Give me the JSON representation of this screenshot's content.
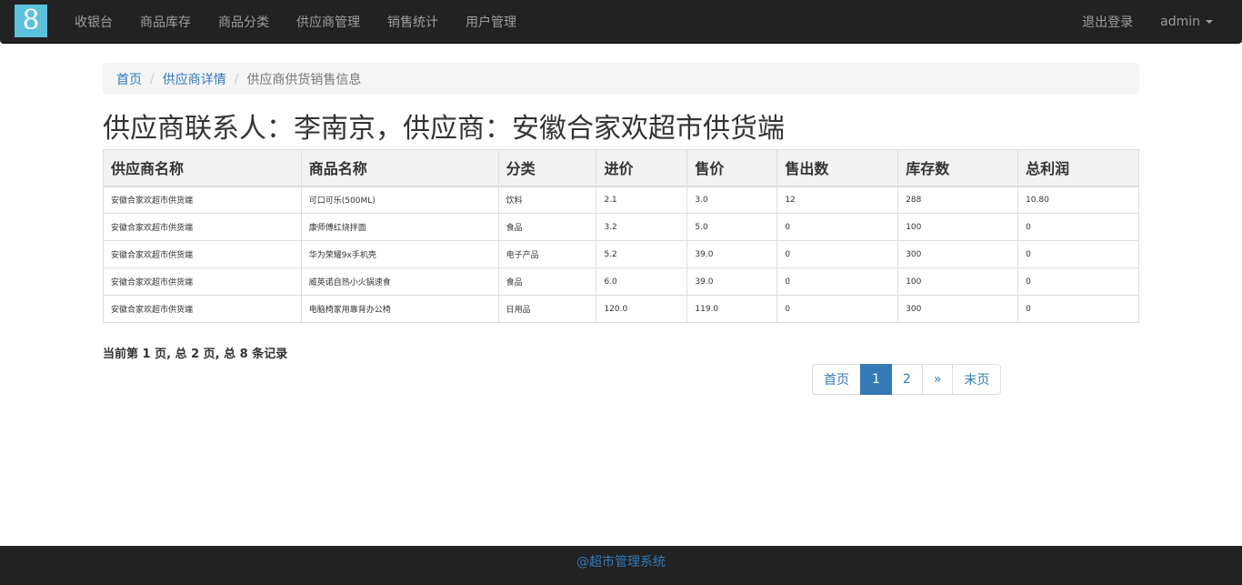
{
  "navbar": {
    "brand": "8",
    "items": [
      "收银台",
      "商品库存",
      "商品分类",
      "供应商管理",
      "销售统计",
      "用户管理"
    ],
    "logout": "退出登录",
    "user": "admin"
  },
  "breadcrumb": [
    "首页",
    "供应商详情",
    "供应商供货销售信息"
  ],
  "title": "供应商联系人：李南京，供应商：安徽合家欢超市供货端",
  "table": {
    "headers": [
      "供应商名称",
      "商品名称",
      "分类",
      "进价",
      "售价",
      "售出数",
      "库存数",
      "总利润"
    ],
    "rows": [
      [
        "安徽合家欢超市供货端",
        "可口可乐(500ML)",
        "饮料",
        "2.1",
        "3.0",
        "12",
        "288",
        "10.80"
      ],
      [
        "安徽合家欢超市供货端",
        "康师傅红烧拌面",
        "食品",
        "3.2",
        "5.0",
        "0",
        "100",
        "0"
      ],
      [
        "安徽合家欢超市供货端",
        "华为荣耀9x手机壳",
        "电子产品",
        "5.2",
        "39.0",
        "0",
        "300",
        "0"
      ],
      [
        "安徽合家欢超市供货端",
        "威英诺自热小火锅速食",
        "食品",
        "6.0",
        "39.0",
        "0",
        "100",
        "0"
      ],
      [
        "安徽合家欢超市供货端",
        "电脑椅家用靠背办公椅",
        "日用品",
        "120.0",
        "119.0",
        "0",
        "300",
        "0"
      ]
    ]
  },
  "pager": {
    "info": "当前第 1 页, 总 2 页, 总 8 条记录",
    "first": "首页",
    "pages": [
      "1",
      "2"
    ],
    "next": "»",
    "last": "末页"
  },
  "footer": "@超市管理系统"
}
